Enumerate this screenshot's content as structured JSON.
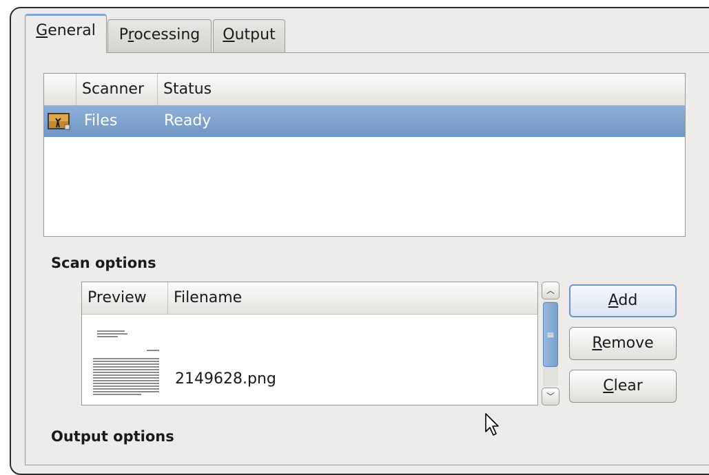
{
  "tabs": [
    {
      "mnemonic": "G",
      "rest": "eneral"
    },
    {
      "pre": "P",
      "mnemonic": "r",
      "rest": "ocessing"
    },
    {
      "mnemonic": "O",
      "rest": "utput"
    }
  ],
  "scanner_list": {
    "columns": [
      "Scanner",
      "Status"
    ],
    "rows": [
      {
        "scanner": "Files",
        "status": "Ready",
        "icon": "image-file-icon"
      }
    ]
  },
  "scan_options": {
    "title": "Scan options",
    "columns": [
      "Preview",
      "Filename"
    ],
    "files": [
      {
        "filename": "2149628.png",
        "icon": "document-thumbnail"
      }
    ]
  },
  "buttons": {
    "add": {
      "mnemonic": "A",
      "rest": "dd"
    },
    "remove": {
      "mnemonic": "R",
      "rest": "emove"
    },
    "clear": {
      "mnemonic": "C",
      "rest": "lear"
    }
  },
  "output_options": {
    "title": "Output options"
  },
  "colors": {
    "selection": "#7aa0cf",
    "focus": "#6c94c8"
  }
}
